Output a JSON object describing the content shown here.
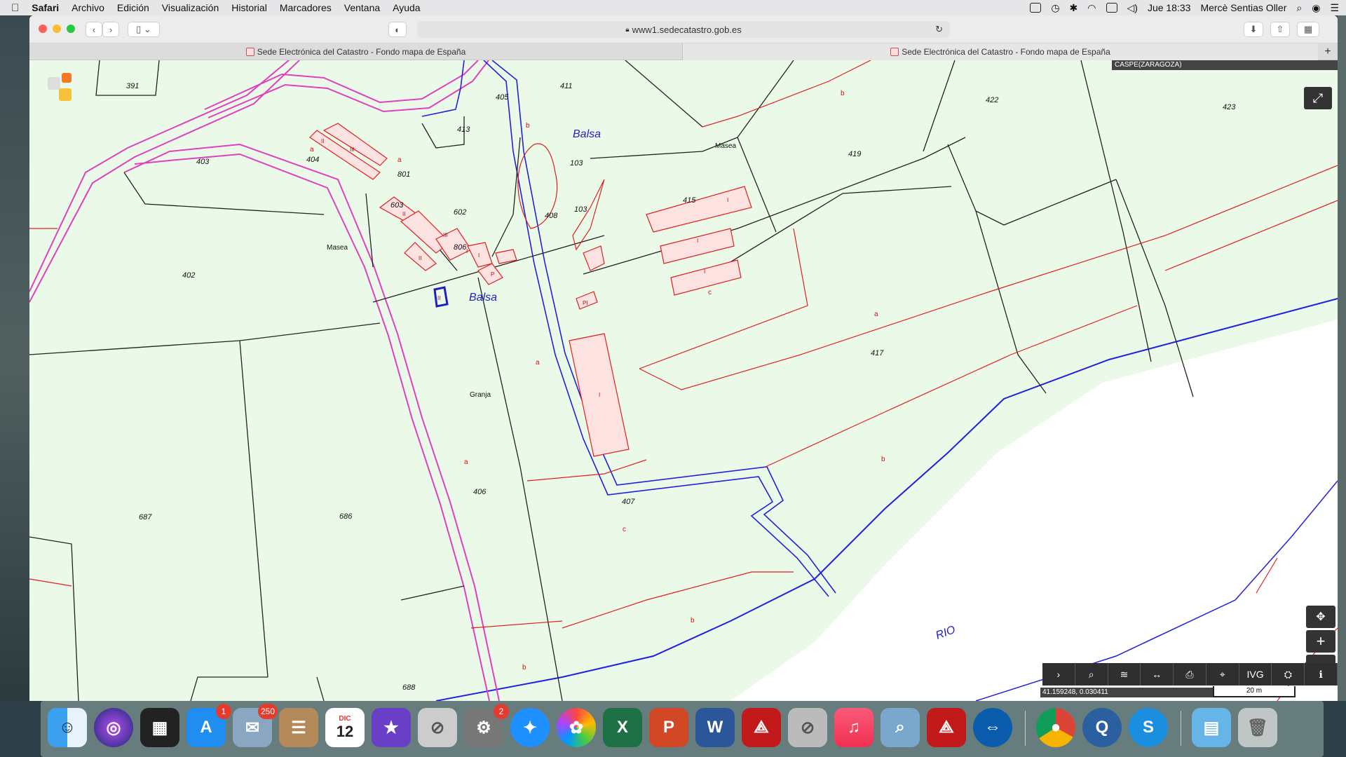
{
  "menubar": {
    "app_name": "Safari",
    "menus": [
      "Archivo",
      "Edición",
      "Visualización",
      "Historial",
      "Marcadores",
      "Ventana",
      "Ayuda"
    ],
    "clock": "Jue 18:33",
    "user": "Mercè Sentias Oller"
  },
  "browser": {
    "url": "www1.sedecatastro.gob.es",
    "tabs": [
      {
        "title": "Sede Electrónica del Catastro - Fondo mapa de España"
      },
      {
        "title": "Sede Electrónica del Catastro - Fondo mapa de España"
      }
    ]
  },
  "map": {
    "region_label": "CASPE(ZARAGOZA)",
    "coordinates": "41.159248, 0.030411",
    "scale_label": "20 m",
    "toolbar": [
      {
        "name": "expand-toolbar-button",
        "label": "›"
      },
      {
        "name": "search-button",
        "label": "⌕"
      },
      {
        "name": "layers-button",
        "label": "≋"
      },
      {
        "name": "measure-button",
        "label": "↔"
      },
      {
        "name": "print-button",
        "label": "⎙"
      },
      {
        "name": "parcel-info-button",
        "label": "⌖"
      },
      {
        "name": "ivg-button",
        "label": "IVG"
      },
      {
        "name": "cadastral-button",
        "label": "⛭"
      },
      {
        "name": "info-button",
        "label": "ℹ"
      }
    ],
    "parcels": [
      "391",
      "403",
      "404",
      "405",
      "411",
      "413",
      "801",
      "603",
      "602",
      "806",
      "408",
      "103",
      "103",
      "415",
      "419",
      "422",
      "423",
      "402",
      "417",
      "407",
      "406",
      "686",
      "687",
      "688"
    ],
    "names": [
      "Balsa",
      "Balsa",
      "Masea",
      "Masea",
      "Granja",
      "RIO"
    ],
    "subparcels": [
      "a",
      "a",
      "b",
      "a",
      "c",
      "a",
      "a",
      "b",
      "c",
      "b",
      "b",
      "b"
    ],
    "uses": [
      "II",
      "III",
      "II",
      "III",
      "II",
      "I",
      "P",
      "I",
      "PI",
      "I",
      "I",
      "I",
      "I",
      "II"
    ]
  },
  "dock": {
    "badges": {
      "app_store": "1",
      "mail": "250",
      "system_prefs": "2"
    },
    "calendar": {
      "month": "DIC",
      "day": "12"
    },
    "word_letter": "W",
    "excel_letter": "X",
    "ppt_letter": "P"
  },
  "colors": {
    "map_bg": "#ebf9e8",
    "parcel_line": "#222222",
    "subparcel_line": "#e02020",
    "road_line": "#e040c0",
    "water_line": "#2020e0",
    "building_fill": "#fde2e2"
  }
}
